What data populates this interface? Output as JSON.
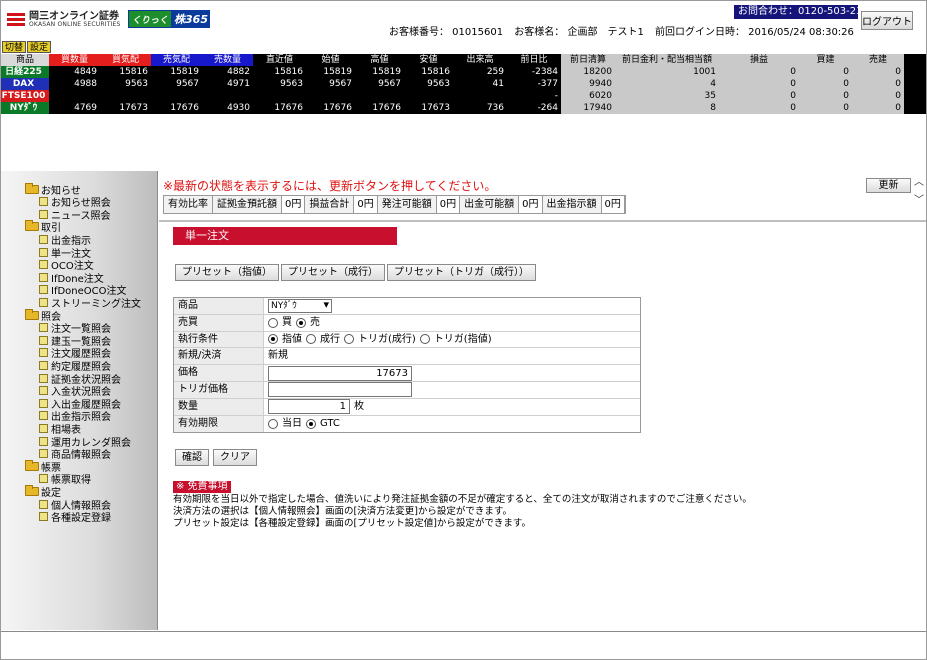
{
  "header": {
    "company_jp": "岡三オンライン証券",
    "company_en": "OKASAN ONLINE SECURITIES",
    "brand_a": "くりっく",
    "brand_b": "株365",
    "account_number": "お客様番号： 01015601",
    "customer_name": "お客様名： 企画部　テスト1",
    "last_login": "前回ログイン日時： 2016/05/24 08:30:26",
    "contact": "お問合わせ：0120-503-239",
    "logout": "ログアウト"
  },
  "ticker_tabs": [
    "切替",
    "設定"
  ],
  "ticker": {
    "columns": [
      "商品",
      "買数量",
      "買気配",
      "売気配",
      "売数量",
      "直近値",
      "始値",
      "高値",
      "安値",
      "出来高",
      "前日比",
      "前日清算",
      "前日金利・配当相当額",
      "損益",
      "買建",
      "売建"
    ],
    "rows": [
      {
        "name": "日経225",
        "vals": [
          "4849",
          "15816",
          "15819",
          "4882",
          "15816",
          "15819",
          "15819",
          "15816",
          "259",
          "-2384",
          "18200",
          "1001",
          "0",
          "0",
          "0"
        ]
      },
      {
        "name": "DAX",
        "vals": [
          "4988",
          "9563",
          "9567",
          "4971",
          "9563",
          "9567",
          "9567",
          "9563",
          "41",
          "-377",
          "9940",
          "4",
          "0",
          "0",
          "0"
        ]
      },
      {
        "name": "FTSE100",
        "vals": [
          "",
          "",
          "",
          "",
          "",
          "",
          "",
          "",
          "",
          "-",
          "6020",
          "35",
          "0",
          "0",
          "0"
        ]
      },
      {
        "name": "NYﾀﾞｳ",
        "vals": [
          "4769",
          "17673",
          "17676",
          "4930",
          "17676",
          "17676",
          "17676",
          "17673",
          "736",
          "-264",
          "17940",
          "8",
          "0",
          "0",
          "0"
        ]
      }
    ],
    "colors": {
      "buy": "#e41d1d",
      "sell": "#1717cc",
      "name_green": "#0a7a28",
      "name_blue": "#1f2fb8",
      "name_red": "#d71a1a"
    }
  },
  "nav": [
    {
      "type": "folder",
      "label": "お知らせ"
    },
    {
      "type": "leaf",
      "label": "お知らせ照会"
    },
    {
      "type": "leaf",
      "label": "ニュース照会"
    },
    {
      "type": "folder",
      "label": "取引"
    },
    {
      "type": "leaf",
      "label": "出金指示"
    },
    {
      "type": "leaf",
      "label": "単一注文"
    },
    {
      "type": "leaf",
      "label": "OCO注文"
    },
    {
      "type": "leaf",
      "label": "IfDone注文"
    },
    {
      "type": "leaf",
      "label": "IfDoneOCO注文"
    },
    {
      "type": "leaf",
      "label": "ストリーミング注文"
    },
    {
      "type": "folder",
      "label": "照会"
    },
    {
      "type": "leaf",
      "label": "注文一覧照会"
    },
    {
      "type": "leaf",
      "label": "建玉一覧照会"
    },
    {
      "type": "leaf",
      "label": "注文履歴照会"
    },
    {
      "type": "leaf",
      "label": "約定履歴照会"
    },
    {
      "type": "leaf",
      "label": "証拠金状況照会"
    },
    {
      "type": "leaf",
      "label": "入金状況照会"
    },
    {
      "type": "leaf",
      "label": "入出金履歴照会"
    },
    {
      "type": "leaf",
      "label": "出金指示照会"
    },
    {
      "type": "leaf",
      "label": "相場表"
    },
    {
      "type": "leaf",
      "label": "運用カレンダ照会"
    },
    {
      "type": "leaf",
      "label": "商品情報照会"
    },
    {
      "type": "folder",
      "label": "帳票"
    },
    {
      "type": "leaf",
      "label": "帳票取得"
    },
    {
      "type": "folder",
      "label": "設定"
    },
    {
      "type": "leaf",
      "label": "個人情報照会"
    },
    {
      "type": "leaf",
      "label": "各種設定登録"
    }
  ],
  "main": {
    "warning": "※最新の状態を表示するには、更新ボタンを押してください。",
    "refresh": "更新",
    "funds": [
      {
        "label": "有効比率",
        "value": ""
      },
      {
        "label": "証拠金預託額",
        "value": "0円"
      },
      {
        "label": "損益合計",
        "value": "0円"
      },
      {
        "label": "発注可能額",
        "value": "0円"
      },
      {
        "label": "出金可能額",
        "value": "0円"
      },
      {
        "label": "出金指示額",
        "value": "0円"
      }
    ],
    "title": "単一注文",
    "presets": [
      "プリセット（指値）",
      "プリセット（成行）",
      "プリセット（トリガ（成行））"
    ],
    "form": {
      "product_label": "商品",
      "product_value": "NYﾀﾞｳ",
      "side_label": "売買",
      "side_buy": "買",
      "side_sell": "売",
      "exec_label": "執行条件",
      "exec_limit": "指値",
      "exec_market": "成行",
      "exec_trig_market": "トリガ(成行)",
      "exec_trig_limit": "トリガ(指値)",
      "newclose_label": "新規/決済",
      "newclose_value": "新規",
      "price_label": "価格",
      "price_value": "17673",
      "trigger_label": "トリガ価格",
      "trigger_value": "",
      "qty_label": "数量",
      "qty_value": "1",
      "qty_unit": "枚",
      "expiry_label": "有効期限",
      "expiry_today": "当日",
      "expiry_gtc": "GTC"
    },
    "confirm": "確認",
    "clear": "クリア",
    "notice_tag": "※ 免責事項",
    "notice_lines": [
      "有効期限を当日以外で指定した場合、値洗いにより発注証拠金額の不足が確定すると、全ての注文が取消されますのでご注意ください。",
      "決済方法の選択は【個人情報照会】画面の[決済方法変更]から設定ができます。",
      "プリセット設定は【各種設定登録】画面の[プリセット設定値]から設定ができます。"
    ]
  }
}
